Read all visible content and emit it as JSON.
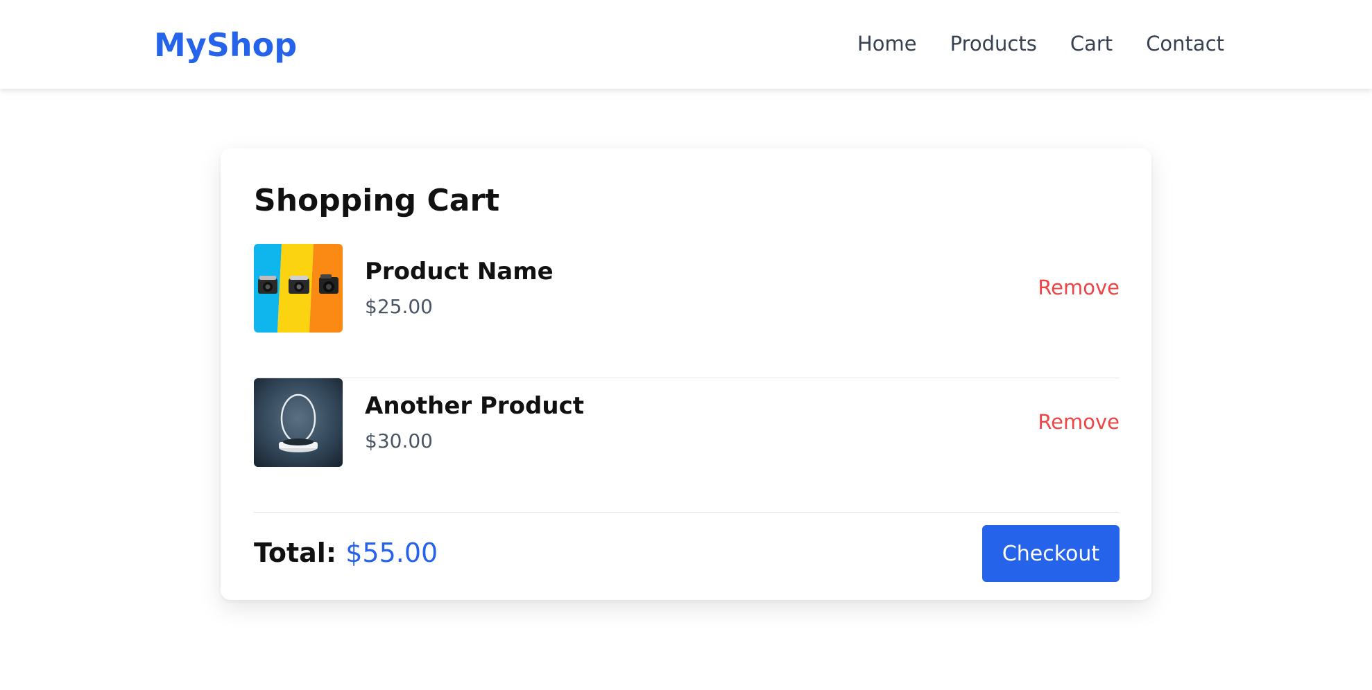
{
  "brand": {
    "name": "MyShop",
    "color": "#2563eb"
  },
  "nav": [
    {
      "label": "Home"
    },
    {
      "label": "Products"
    },
    {
      "label": "Cart"
    },
    {
      "label": "Contact"
    }
  ],
  "cart": {
    "title": "Shopping Cart",
    "items": [
      {
        "name": "Product Name",
        "price": "$25.00",
        "remove_label": "Remove",
        "image": "cameras-on-colorful-stripes"
      },
      {
        "name": "Another Product",
        "price": "$30.00",
        "remove_label": "Remove",
        "image": "illuminated-ring-lamp-product"
      }
    ],
    "total_label": "Total:",
    "total_value": "$55.00",
    "checkout_label": "Checkout"
  },
  "colors": {
    "accent": "#2563eb",
    "danger": "#ef4444",
    "text_muted": "#4b5563"
  }
}
